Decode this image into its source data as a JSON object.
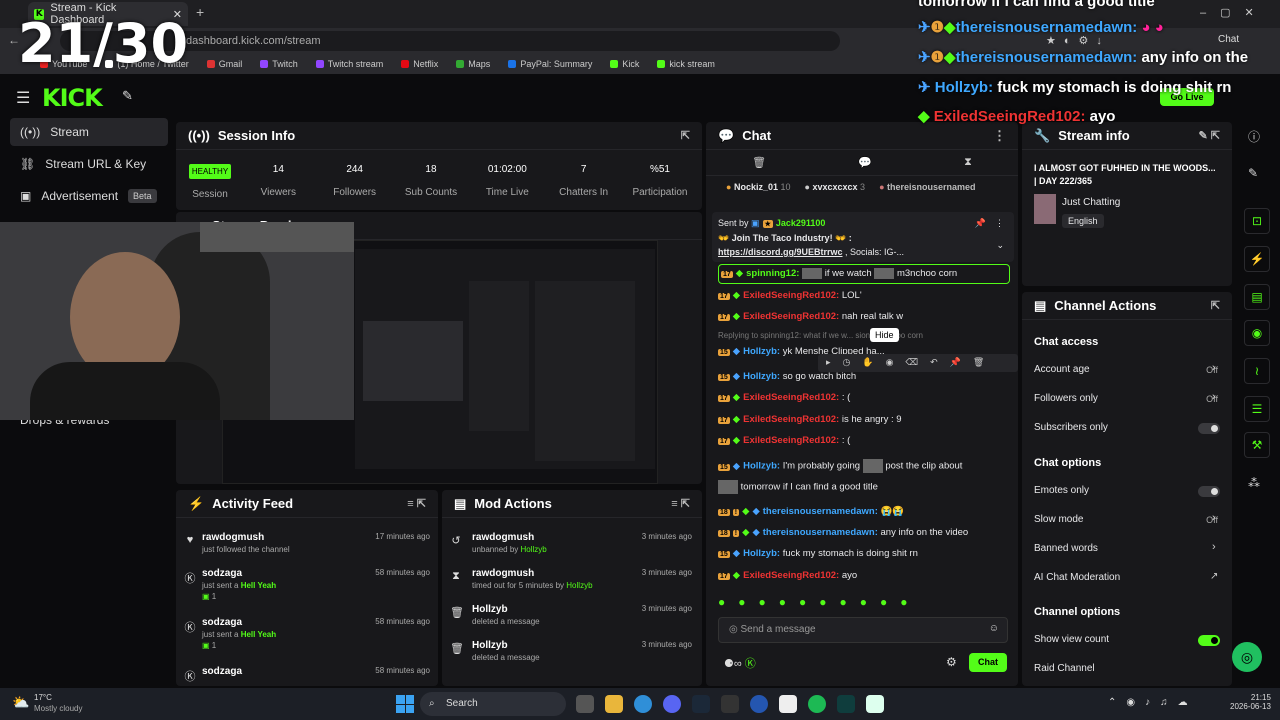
{
  "overlay_counter": "21/30",
  "browser": {
    "tab_title": "Stream - Kick Dashboard",
    "url": "dashboard.kick.com/stream",
    "bookmarks": [
      "YouTube",
      "(1) Home / Twitter",
      "Gmail",
      "Twitch",
      "Twitch stream",
      "Netflix",
      "Maps",
      "PayPal: Summary",
      "Kick",
      "kick stream"
    ],
    "chat_button": "Chat"
  },
  "overlay_chat": [
    {
      "user": "thereisnousernamedawn:",
      "text": "tomorrow if I can find a good title"
    },
    {
      "user": "thereisnousernamedawn:",
      "text": ""
    },
    {
      "user": "thereisnousernamedawn:",
      "text": "any info on the"
    },
    {
      "user": "Hollzyb:",
      "text": "fuck my stomach is doing shit rn"
    },
    {
      "user": "ExiledSeeingRed102:",
      "text": "ayo"
    }
  ],
  "topbar": {
    "logo": "KICK",
    "go_live": "Go Live"
  },
  "sidebar": {
    "items": [
      {
        "label": "Stream"
      },
      {
        "label": "Stream URL & Key"
      },
      {
        "label": "Advertisement",
        "badge": "Beta"
      },
      {
        "label": "Drops & rewards"
      }
    ]
  },
  "session": {
    "title": "Session Info",
    "stats": [
      {
        "value": "HEALTHY",
        "label": "Session"
      },
      {
        "value": "14",
        "label": "Viewers"
      },
      {
        "value": "244",
        "label": "Followers"
      },
      {
        "value": "18",
        "label": "Sub Counts"
      },
      {
        "value": "01:02:00",
        "label": "Time Live"
      },
      {
        "value": "7",
        "label": "Chatters In"
      },
      {
        "value": "%51",
        "label": "Participation"
      }
    ]
  },
  "preview": {
    "title": "Stream Preview"
  },
  "activity": {
    "title": "Activity Feed",
    "items": [
      {
        "name": "rawdogmush",
        "sub": "just followed the channel",
        "time": "17 minutes ago"
      },
      {
        "name": "sodzaga",
        "sub": "just sent a",
        "gift": "Hell Yeah",
        "count": "1",
        "time": "58 minutes ago"
      },
      {
        "name": "sodzaga",
        "sub": "just sent a",
        "gift": "Hell Yeah",
        "count": "1",
        "time": "58 minutes ago"
      },
      {
        "name": "sodzaga",
        "sub": "",
        "time": "58 minutes ago"
      }
    ]
  },
  "mod": {
    "title": "Mod Actions",
    "items": [
      {
        "name": "rawdogmush",
        "sub": "unbanned by",
        "by": "Hollzyb",
        "time": "3 minutes ago"
      },
      {
        "name": "rawdogmush",
        "sub": "timed out for 5 minutes by",
        "by": "Hollzyb",
        "time": "3 minutes ago"
      },
      {
        "name": "Hollzyb",
        "sub": "deleted a message",
        "by": "",
        "time": "3 minutes ago"
      },
      {
        "name": "Hollzyb",
        "sub": "deleted a message",
        "by": "",
        "time": "3 minutes ago"
      }
    ]
  },
  "chat": {
    "title": "Chat",
    "leaders": [
      {
        "name": "Nockiz_01",
        "count": "10"
      },
      {
        "name": "xvxcxcxcx",
        "count": "3"
      },
      {
        "name": "thereisnousernamed",
        "count": ""
      }
    ],
    "pinned": {
      "sent_by": "Sent by",
      "user": "Jack291100",
      "text": "Join The Taco Industry!",
      "link": "https://discord.gg/9UEBtrrwc",
      "rest": ", Socials: IG-..."
    },
    "hide_tooltip": "Hide",
    "reply_note": "Replying to spinning12: what if we w... sion m3nchoo corn",
    "messages": [
      {
        "badge": "17",
        "user": "spinning12:",
        "text": "if we watch",
        "text2": "m3nchoo corn",
        "color": "green"
      },
      {
        "badge": "17",
        "user": "ExiledSeeingRed102:",
        "text": "LOL'",
        "color": "red"
      },
      {
        "badge": "17",
        "user": "ExiledSeeingRed102:",
        "text": "nah real talk w",
        "color": "red"
      },
      {
        "badge": "15",
        "user": "Hollzyb:",
        "text": "yk Menshe Clipped ha...",
        "color": "blue"
      },
      {
        "badge": "15",
        "user": "Hollzyb:",
        "text": "so go watch bitch",
        "color": "blue"
      },
      {
        "badge": "17",
        "user": "ExiledSeeingRed102:",
        "text": ": (",
        "color": "red"
      },
      {
        "badge": "17",
        "user": "ExiledSeeingRed102:",
        "text": "is he angry : 9",
        "color": "red"
      },
      {
        "badge": "17",
        "user": "ExiledSeeingRed102:",
        "text": ": (",
        "color": "red"
      },
      {
        "badge": "15",
        "user": "Hollzyb:",
        "text": "I'm probably going",
        "text2": "post the clip about",
        "color": "blue"
      },
      {
        "badge": "",
        "user": "",
        "text": "tomorrow if I can find a good title",
        "color": "none"
      },
      {
        "badge": "18",
        "user": "thereisnousernamedawn:",
        "text": "😭😭",
        "color": "blue"
      },
      {
        "badge": "18",
        "user": "thereisnousernamedawn:",
        "text": "any info on the video",
        "color": "blue"
      },
      {
        "badge": "15",
        "user": "Hollzyb:",
        "text": "fuck my stomach is doing shit rn",
        "color": "blue"
      },
      {
        "badge": "17",
        "user": "ExiledSeeingRed102:",
        "text": "ayo",
        "color": "red"
      }
    ],
    "input_placeholder": "Send a message",
    "send_button": "Chat"
  },
  "stream_info": {
    "title": "Stream info",
    "stream_title": "I ALMOST GOT FUHHED IN THE WOODS... | DAY 222/365",
    "category": "Just Chatting",
    "language": "English"
  },
  "channel_actions": {
    "title": "Channel Actions",
    "chat_access": "Chat access",
    "account_age": {
      "label": "Account age",
      "value": "Off"
    },
    "followers_only": {
      "label": "Followers only",
      "value": "Off"
    },
    "subscribers_only": {
      "label": "Subscribers only"
    },
    "chat_options": "Chat options",
    "emotes_only": {
      "label": "Emotes only"
    },
    "slow_mode": {
      "label": "Slow mode",
      "value": "Off"
    },
    "banned_words": {
      "label": "Banned words"
    },
    "ai_moderation": {
      "label": "AI Chat Moderation"
    },
    "channel_options": "Channel options",
    "show_view_count": {
      "label": "Show view count"
    },
    "raid_channel": {
      "label": "Raid Channel"
    }
  },
  "taskbar": {
    "weather_temp": "17°C",
    "weather_desc": "Mostly cloudy",
    "search": "Search",
    "time": "21:15",
    "date": "2026-06-13"
  }
}
